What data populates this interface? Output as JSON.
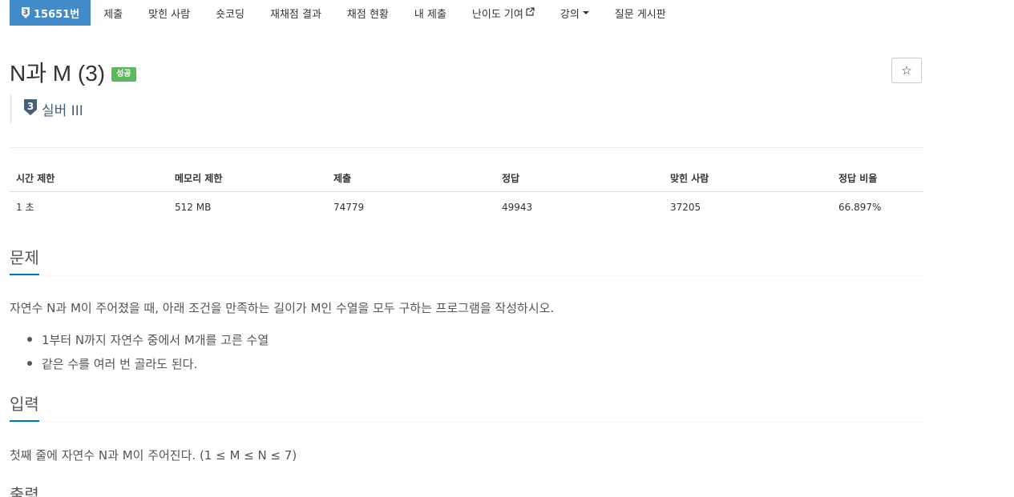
{
  "nav": {
    "problem_badge": "3",
    "problem_number": "15651번",
    "items": [
      {
        "label": "제출"
      },
      {
        "label": "맞힌 사람"
      },
      {
        "label": "숏코딩"
      },
      {
        "label": "재채점 결과"
      },
      {
        "label": "채점 현황"
      },
      {
        "label": "내 제출"
      },
      {
        "label": "난이도 기여"
      },
      {
        "label": "강의"
      },
      {
        "label": "질문 게시판"
      }
    ]
  },
  "problem": {
    "title": "N과 M (3)",
    "status": "성공",
    "tier_number": "3",
    "tier": "실버 III"
  },
  "stats": {
    "headers": [
      "시간 제한",
      "메모리 제한",
      "제출",
      "정답",
      "맞힌 사람",
      "정답 비율"
    ],
    "values": [
      "1 초",
      "512 MB",
      "74779",
      "49943",
      "37205",
      "66.897%"
    ]
  },
  "sections": {
    "problem_heading": "문제",
    "problem_text": "자연수 N과 M이 주어졌을 때, 아래 조건을 만족하는 길이가 M인 수열을 모두 구하는 프로그램을 작성하시오.",
    "conditions": [
      "1부터 N까지 자연수 중에서 M개를 고른 수열",
      "같은 수를 여러 번 골라도 된다."
    ],
    "input_heading": "입력",
    "input_text": "첫째 줄에 자연수 N과 M이 주어진다. (1 ≤ M ≤ N ≤ 7)",
    "output_heading": "출력"
  },
  "colors": {
    "nav_active": "#428bca",
    "success": "#5cb85c",
    "tier_silver": "#435f7a",
    "section_underline": "#0076c0"
  }
}
